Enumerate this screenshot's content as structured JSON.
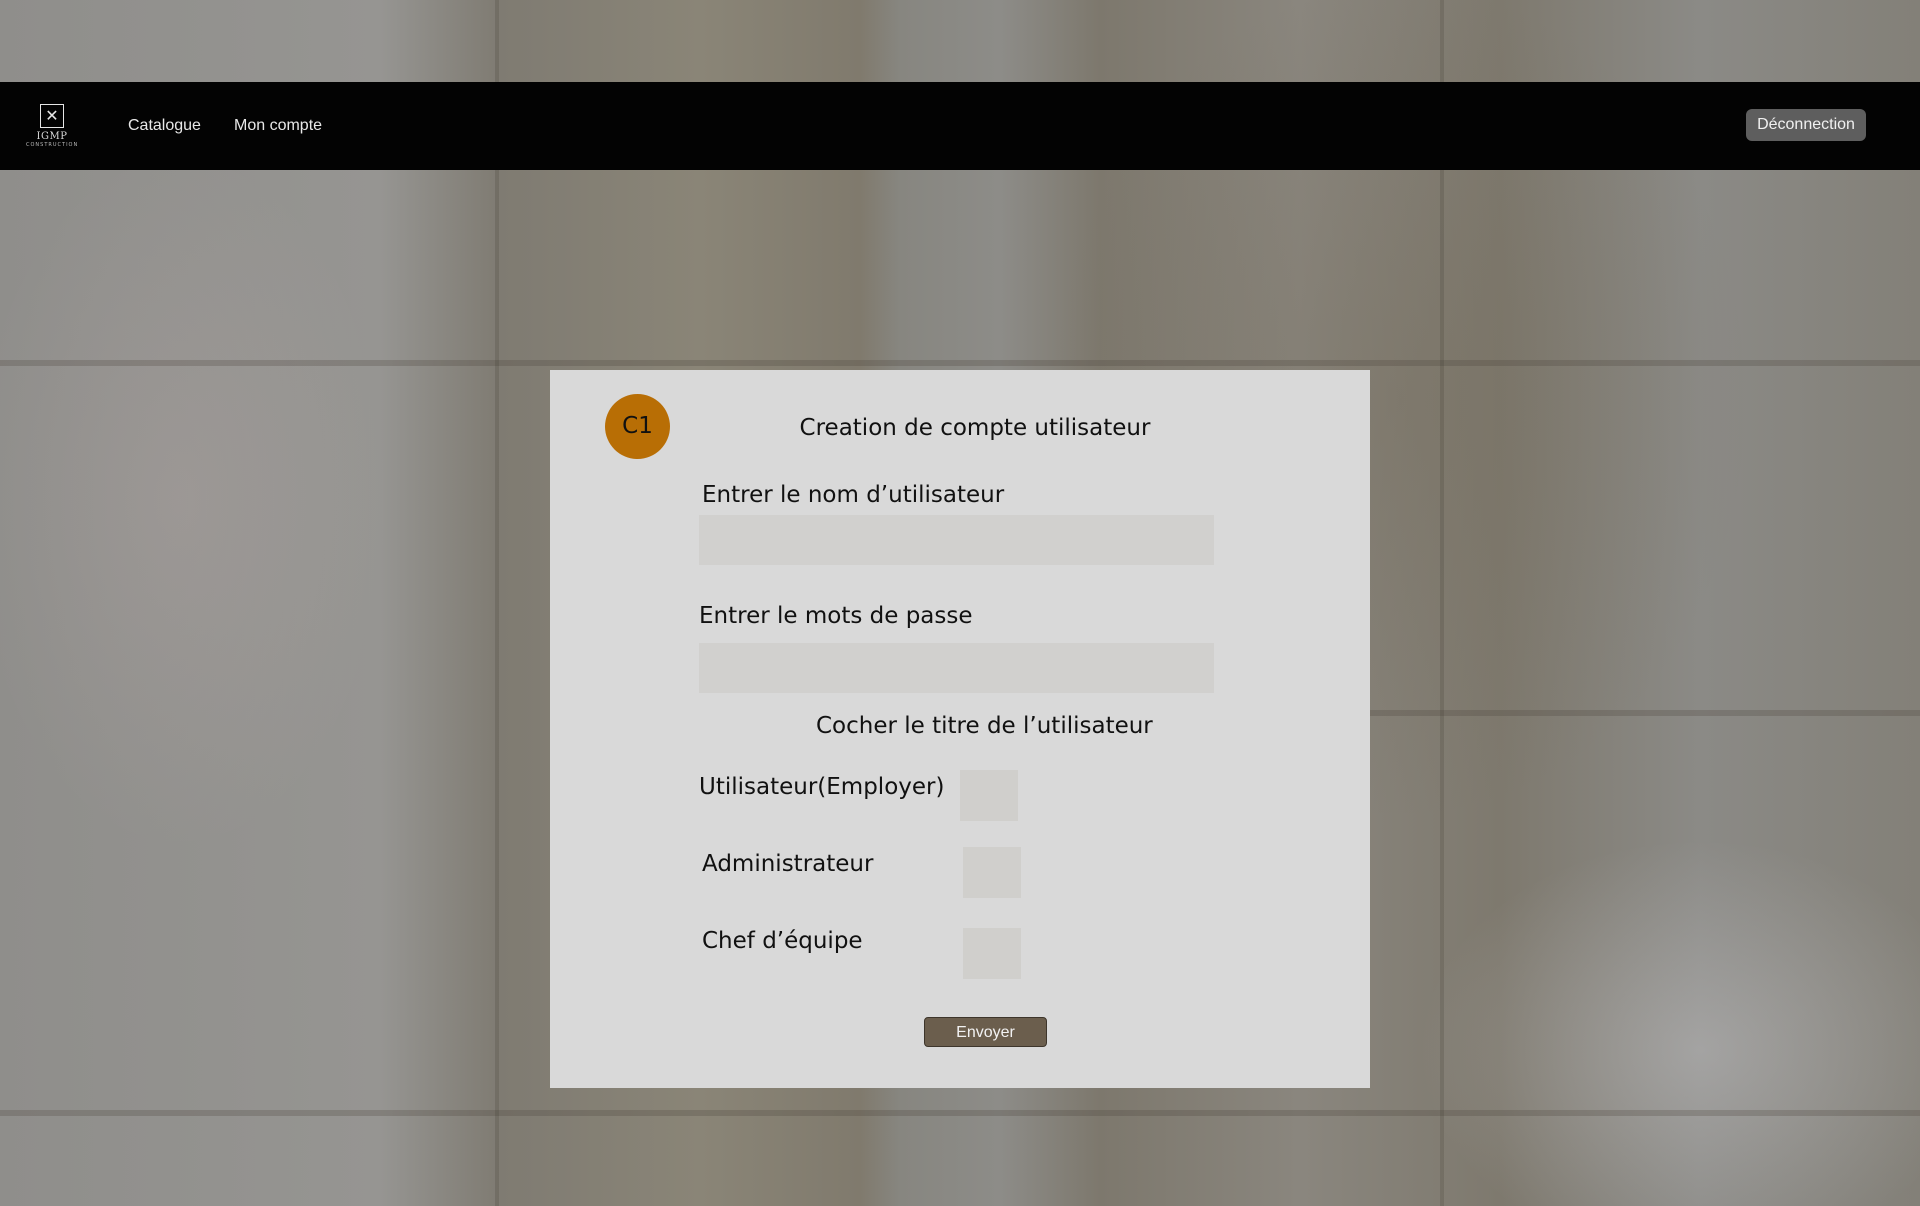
{
  "nav": {
    "logo": {
      "name": "IGMP",
      "tagline": "CONSTRUCTION"
    },
    "links": [
      {
        "label": "Catalogue"
      },
      {
        "label": "Mon compte"
      }
    ],
    "logout_label": "Déconnection"
  },
  "form": {
    "avatar_text": "C1",
    "title": "Creation de compte utilisateur",
    "username_label": "Entrer le nom d’utilisateur",
    "username_value": "",
    "password_label": "Entrer le mots de passe",
    "password_value": "",
    "role_heading": "Cocher le titre de l’utilisateur",
    "roles": [
      {
        "label": "Utilisateur(Employer)",
        "checked": false
      },
      {
        "label": "Administrateur",
        "checked": false
      },
      {
        "label": "Chef d’équipe",
        "checked": false
      }
    ],
    "submit_label": "Envoyer"
  },
  "colors": {
    "navbar": "#030303",
    "card": "#d9d9d9",
    "avatar": "#b86e05",
    "submit": "#6b5e4d"
  },
  "icons": {
    "logo": "tools-icon"
  }
}
